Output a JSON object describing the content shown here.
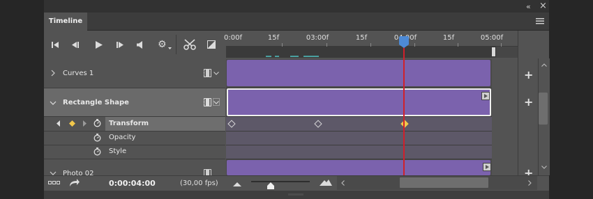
{
  "panel": {
    "tab_title": "Timeline",
    "collapse_glyph": "«",
    "close_glyph": "×",
    "menu_icon": "hamburger-menu-icon"
  },
  "controls": {
    "icons": [
      "go-to-first-frame-icon",
      "previous-frame-icon",
      "play-icon",
      "next-frame-icon",
      "audio-icon",
      "settings-gear-icon",
      "split-scissors-icon",
      "transition-icon"
    ]
  },
  "ruler": {
    "labels": [
      "0:00f",
      "15f",
      "03:00f",
      "15f",
      "04:00f",
      "15f",
      "05:00f"
    ]
  },
  "layers": [
    {
      "name": "Curves 1",
      "expanded": false
    },
    {
      "name": "Rectangle Shape",
      "expanded": true
    },
    {
      "name": "Photo 02",
      "expanded": false
    }
  ],
  "properties": [
    {
      "name": "Transform",
      "selected": true
    },
    {
      "name": "Opacity",
      "selected": false
    },
    {
      "name": "Style",
      "selected": false
    }
  ],
  "status": {
    "current_time": "0:00:04:00",
    "fps": "(30,00 fps)"
  },
  "colors": {
    "clip": "#7b62ad",
    "playhead": "#d0202b",
    "playhead_marker": "#4d8ad6",
    "keyframe_active": "#f2c84b"
  }
}
